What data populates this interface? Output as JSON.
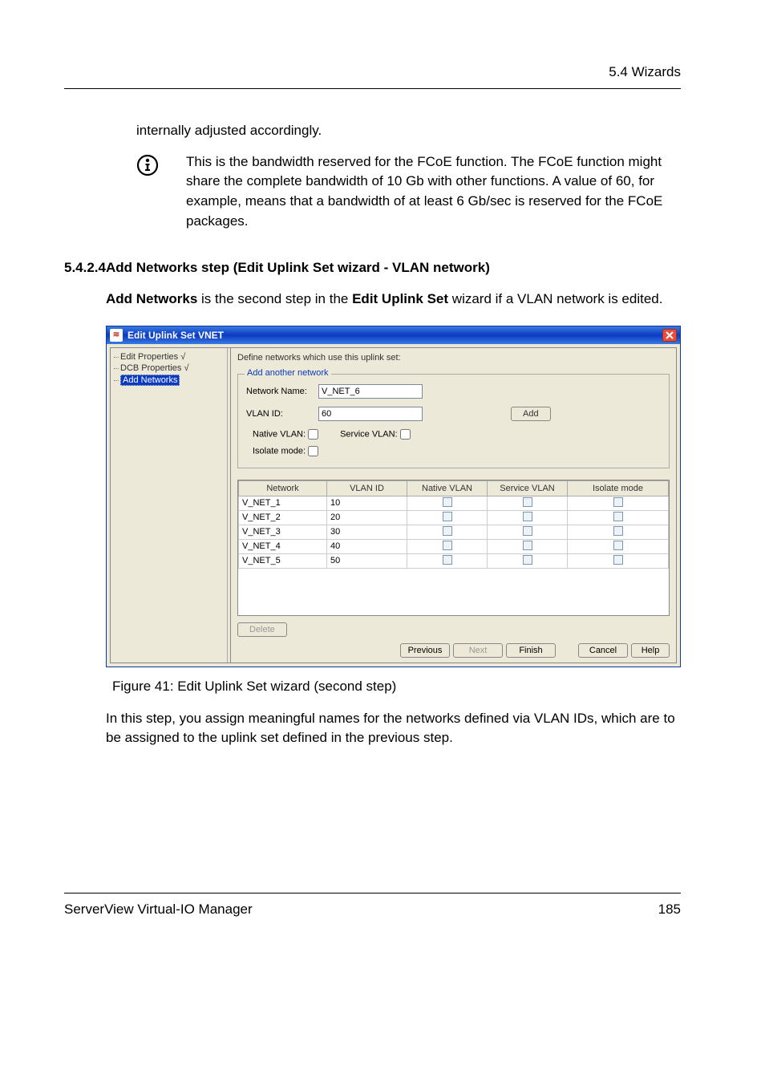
{
  "header": {
    "section_label": "5.4 Wizards"
  },
  "para_adjusted": "internally adjusted accordingly.",
  "info_paragraph": "This is the bandwidth reserved for the FCoE function. The FCoE function might share the complete bandwidth of 10 Gb with other functions. A value of 60, for example, means that a bandwidth of at least 6 Gb/sec is reserved for the FCoE packages.",
  "section": {
    "number": "5.4.2.4",
    "title": "Add Networks step (Edit Uplink Set wizard - VLAN network)"
  },
  "intro_before": "Add Networks",
  "intro_mid": " is the second step in the ",
  "intro_bold2": "Edit Uplink Set",
  "intro_after": " wizard if a VLAN network is edited.",
  "window": {
    "title": "Edit Uplink Set VNET",
    "tree": {
      "item1": "Edit Properties √",
      "item2": "DCB Properties √",
      "item3": "Add Networks"
    },
    "heading": "Define networks which use this uplink set:",
    "fieldset_legend": "Add another network",
    "form": {
      "network_name_label": "Network Name:",
      "network_name_value": "V_NET_6",
      "vlan_id_label": "VLAN ID:",
      "vlan_id_value": "60",
      "add_button": "Add",
      "native_vlan_label": "Native VLAN:",
      "service_vlan_label": "Service VLAN:",
      "isolate_mode_label": "Isolate mode:"
    },
    "table": {
      "headers": {
        "network": "Network",
        "vlan_id": "VLAN ID",
        "native_vlan": "Native VLAN",
        "service_vlan": "Service VLAN",
        "isolate_mode": "Isolate mode"
      },
      "rows": [
        {
          "network": "V_NET_1",
          "vlan_id": "10"
        },
        {
          "network": "V_NET_2",
          "vlan_id": "20"
        },
        {
          "network": "V_NET_3",
          "vlan_id": "30"
        },
        {
          "network": "V_NET_4",
          "vlan_id": "40"
        },
        {
          "network": "V_NET_5",
          "vlan_id": "50"
        }
      ]
    },
    "delete_button": "Delete",
    "footer": {
      "previous": "Previous",
      "next": "Next",
      "finish": "Finish",
      "cancel": "Cancel",
      "help": "Help"
    }
  },
  "figure_caption": "Figure 41: Edit Uplink Set wizard (second step)",
  "closing_para": "In this step, you assign meaningful names for the networks defined via VLAN IDs, which are to be assigned to the uplink set defined in the previous step.",
  "footer": {
    "product": "ServerView Virtual-IO Manager",
    "page_number": "185"
  }
}
